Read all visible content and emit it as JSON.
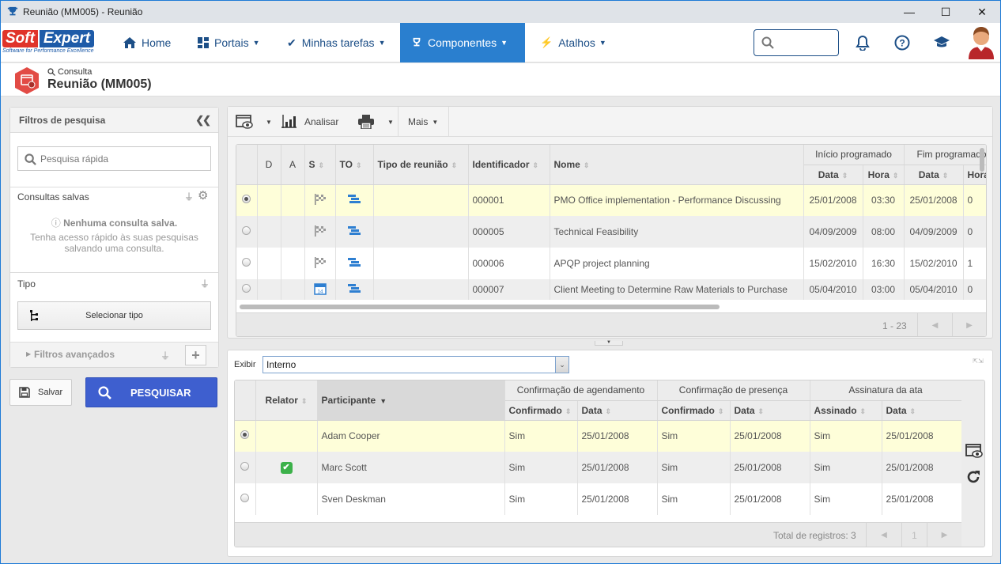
{
  "window": {
    "title": "Reunião (MM005) - Reunião",
    "controls": {
      "minimize": "—",
      "maximize": "☐",
      "close": "✕"
    }
  },
  "topnav": {
    "logo": {
      "brand_a": "Soft",
      "brand_b": "Expert",
      "tagline": "Software for Performance Excellence"
    },
    "items": [
      {
        "label": "Home",
        "icon": "home-icon"
      },
      {
        "label": "Portais",
        "icon": "grid-icon",
        "dropdown": true
      },
      {
        "label": "Minhas tarefas",
        "icon": "check-icon",
        "dropdown": true
      },
      {
        "label": "Componentes",
        "icon": "trophy-icon",
        "dropdown": true,
        "active": true
      },
      {
        "label": "Atalhos",
        "icon": "bolt-icon",
        "dropdown": true
      }
    ],
    "search_placeholder": "",
    "accent_color": "#2a7fcf"
  },
  "pagehead": {
    "crumb": "Consulta",
    "title": "Reunião (MM005)"
  },
  "filters": {
    "title": "Filtros de pesquisa",
    "quick_search_placeholder": "Pesquisa rápida",
    "saved_title": "Consultas salvas",
    "saved_empty": "Nenhuma consulta salva.",
    "saved_hint_1": "Tenha acesso rápido às suas pesquisas",
    "saved_hint_2": "salvando uma consulta.",
    "tipo_title": "Tipo",
    "select_tipo": "Selecionar tipo",
    "advanced": "Filtros avançados",
    "save_button": "Salvar",
    "search_button": "PESQUISAR"
  },
  "toolbar": {
    "analyze": "Analisar",
    "more": "Mais"
  },
  "meetings": {
    "headers": {
      "d": "D",
      "a": "A",
      "s": "S",
      "to": "TO",
      "type": "Tipo de reunião",
      "id": "Identificador",
      "name": "Nome",
      "start_group": "Início programado",
      "end_group": "Fim programado",
      "date": "Data",
      "time": "Hora"
    },
    "rows": [
      {
        "s_icon": "flag",
        "id": "000001",
        "name": "PMO Office implementation - Performance Discussing",
        "start_date": "25/01/2008",
        "start_time": "03:30",
        "end_date": "25/01/2008",
        "end_time": "0",
        "selected": true
      },
      {
        "s_icon": "flag",
        "id": "000005",
        "name": "Technical Feasibility",
        "start_date": "04/09/2009",
        "start_time": "08:00",
        "end_date": "04/09/2009",
        "end_time": "0"
      },
      {
        "s_icon": "flag",
        "id": "000006",
        "name": "APQP project planning",
        "start_date": "15/02/2010",
        "start_time": "16:30",
        "end_date": "15/02/2010",
        "end_time": "1"
      },
      {
        "s_icon": "calendar",
        "id": "000007",
        "name": "Client Meeting to Determine Raw Materials to Purchase",
        "start_date": "05/04/2010",
        "start_time": "03:00",
        "end_date": "05/04/2010",
        "end_time": "0"
      }
    ],
    "range": "1 - 23"
  },
  "participants": {
    "show_label": "Exibir",
    "show_value": "Interno",
    "headers": {
      "reporter": "Relator",
      "participant": "Participante",
      "sched_group": "Confirmação de agendamento",
      "pres_group": "Confirmação de presença",
      "sign_group": "Assinatura da ata",
      "confirmed": "Confirmado",
      "date": "Data",
      "signed": "Assinado"
    },
    "rows": [
      {
        "reporter": false,
        "name": "Adam Cooper",
        "sched_conf": "Sim",
        "sched_date": "25/01/2008",
        "pres_conf": "Sim",
        "pres_date": "25/01/2008",
        "signed": "Sim",
        "sign_date": "25/01/2008",
        "selected": true
      },
      {
        "reporter": true,
        "name": "Marc Scott",
        "sched_conf": "Sim",
        "sched_date": "25/01/2008",
        "pres_conf": "Sim",
        "pres_date": "25/01/2008",
        "signed": "Sim",
        "sign_date": "25/01/2008"
      },
      {
        "reporter": false,
        "name": "Sven Deskman",
        "sched_conf": "Sim",
        "sched_date": "25/01/2008",
        "pres_conf": "Sim",
        "pres_date": "25/01/2008",
        "signed": "Sim",
        "sign_date": "25/01/2008"
      }
    ],
    "total": "Total de registros: 3",
    "page": "1"
  }
}
